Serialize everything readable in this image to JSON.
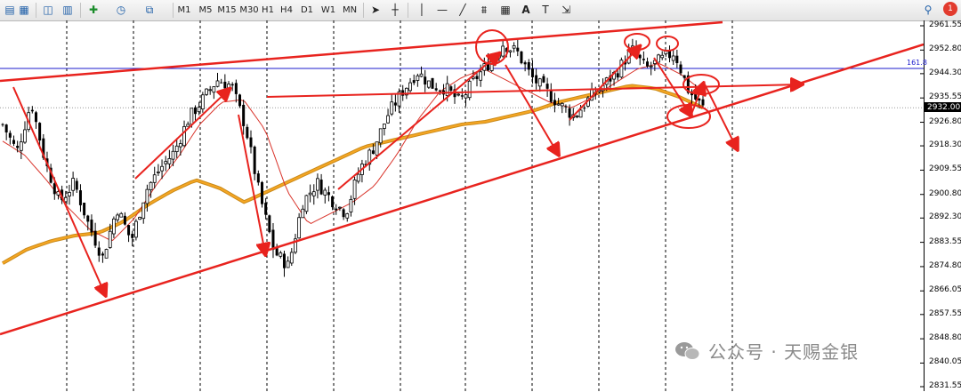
{
  "toolbar": {
    "timeframes": [
      "M1",
      "M5",
      "M15",
      "M30",
      "H1",
      "H4",
      "D1",
      "W1",
      "MN"
    ],
    "tool_icons": [
      "new-chart-icon",
      "profiles-icon",
      "chart-properties-icon",
      "indicators-icon",
      "clock-icon",
      "templates-icon",
      "cursor-icon",
      "crosshair-icon",
      "hline-icon",
      "trendline-icon",
      "fibonacci-icon",
      "grid-icon",
      "text-icon",
      "text-label-icon",
      "arrows-icon"
    ],
    "search_icon": "search-icon",
    "notification_count": "1"
  },
  "chart_data": {
    "type": "candlestick",
    "title": "",
    "y_ticks": [
      "2961.55",
      "2952.80",
      "2944.30",
      "2935.55",
      "2926.80",
      "2918.30",
      "2909.55",
      "2900.80",
      "2892.30",
      "2883.55",
      "2874.80",
      "2866.05",
      "2857.55",
      "2848.80",
      "2840.05",
      "2831.55"
    ],
    "ylim": [
      2831.55,
      2961.55
    ],
    "current_price": "2932.00",
    "fib_label": "161.8",
    "fib_level": 2946.2,
    "close_path": [
      2926,
      2916,
      2934,
      2912,
      2898,
      2905,
      2890,
      2878,
      2896,
      2884,
      2902,
      2910,
      2916,
      2928,
      2935,
      2942,
      2940,
      2925,
      2900,
      2880,
      2875,
      2898,
      2905,
      2899,
      2894,
      2910,
      2918,
      2930,
      2938,
      2945,
      2940,
      2939,
      2934,
      2942,
      2948,
      2955,
      2952,
      2943,
      2938,
      2933,
      2929,
      2935,
      2940,
      2945,
      2953,
      2946,
      2949,
      2952,
      2938,
      2932
    ],
    "ma_slow": [
      2876,
      2881,
      2884,
      2886,
      2887,
      2891,
      2897,
      2902,
      2906,
      2903,
      2898,
      2902,
      2906,
      2910,
      2914,
      2918,
      2920,
      2922,
      2924,
      2926,
      2927,
      2929,
      2931,
      2934,
      2936,
      2938,
      2940,
      2939,
      2936,
      2932
    ],
    "ma_fast": [
      2920,
      2915,
      2906,
      2896,
      2888,
      2884,
      2892,
      2904,
      2914,
      2926,
      2934,
      2935,
      2924,
      2902,
      2890,
      2894,
      2898,
      2904,
      2915,
      2928,
      2938,
      2943,
      2946,
      2942,
      2938,
      2934,
      2932,
      2936,
      2941,
      2946,
      2948,
      2944,
      2938
    ],
    "colors": {
      "candles": "#000000",
      "ma_slow": "#f5a623",
      "ma_slow_edge": "#c98a1a",
      "ma_fast": "#d9342b",
      "annotation": "#e8231e",
      "fib": "#1b1bcc",
      "grid": "#000000"
    }
  },
  "watermark": {
    "text": "公众号 · 天赐金银"
  }
}
